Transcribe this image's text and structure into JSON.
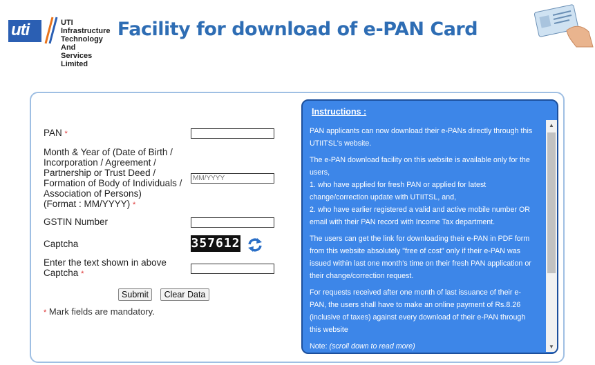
{
  "header": {
    "logo_mark": "uti",
    "org_name_line1": "UTI Infrastructure",
    "org_name_line2": "Technology And",
    "org_name_line3": "Services Limited",
    "title": "Facility for download of e-PAN Card"
  },
  "form": {
    "pan_label": "PAN",
    "dob_label_l1": "Month & Year of (Date of Birth /",
    "dob_label_l2": "Incorporation / Agreement /",
    "dob_label_l3": "Partnership or Trust Deed /",
    "dob_label_l4": "Formation of Body of Individuals /",
    "dob_label_l5": "Association of Persons)",
    "dob_label_l6": "(Format : MM/YYYY)",
    "dob_placeholder": "MM/YYYY",
    "gstin_label": "GSTIN Number",
    "captcha_label": "Captcha",
    "captcha_value": "357612",
    "captcha_text_label_l1": "Enter the text shown in above",
    "captcha_text_label_l2": "Captcha",
    "required_marker": "*",
    "submit_label": "Submit",
    "clear_label": "Clear Data",
    "mandatory_note": "Mark fields are mandatory."
  },
  "instructions": {
    "heading": "Instructions :",
    "p1_l1": "PAN applicants can now download their e-PANs directly through this",
    "p1_l2": "UTIITSL's website.",
    "p2_l1": "The e-PAN download facility on this website is available only for the",
    "p2_l2": "users,",
    "p2_l3": "1. who have applied for fresh PAN or applied for latest",
    "p2_l4": "change/correction update with UTIITSL, and,",
    "p2_l5": "2. who have earlier registered a valid and active mobile number OR",
    "p2_l6": "email with their PAN record with Income Tax department.",
    "p3_l1": "The users can get the link for downloading their e-PAN in PDF form",
    "p3_l2": "from this website absolutely \"free of cost\" only if their e-PAN was",
    "p3_l3": "issued within last one month's time on their fresh PAN application or",
    "p3_l4": "their change/correction request.",
    "p4_l1": "For requests received after one month of last issuance of their e-",
    "p4_l2": "PAN, the users shall have to make an online payment of Rs.8.26",
    "p4_l3": "(inclusive of taxes) against every download of their e-PAN through",
    "p4_l4": "this website",
    "note_label": "Note:",
    "note_text": "(scroll down to read more)"
  },
  "colors": {
    "title": "#2e6db4",
    "instructions_bg": "#3d86e8",
    "panel_border": "#9fbfe3",
    "required": "#dd3333"
  }
}
